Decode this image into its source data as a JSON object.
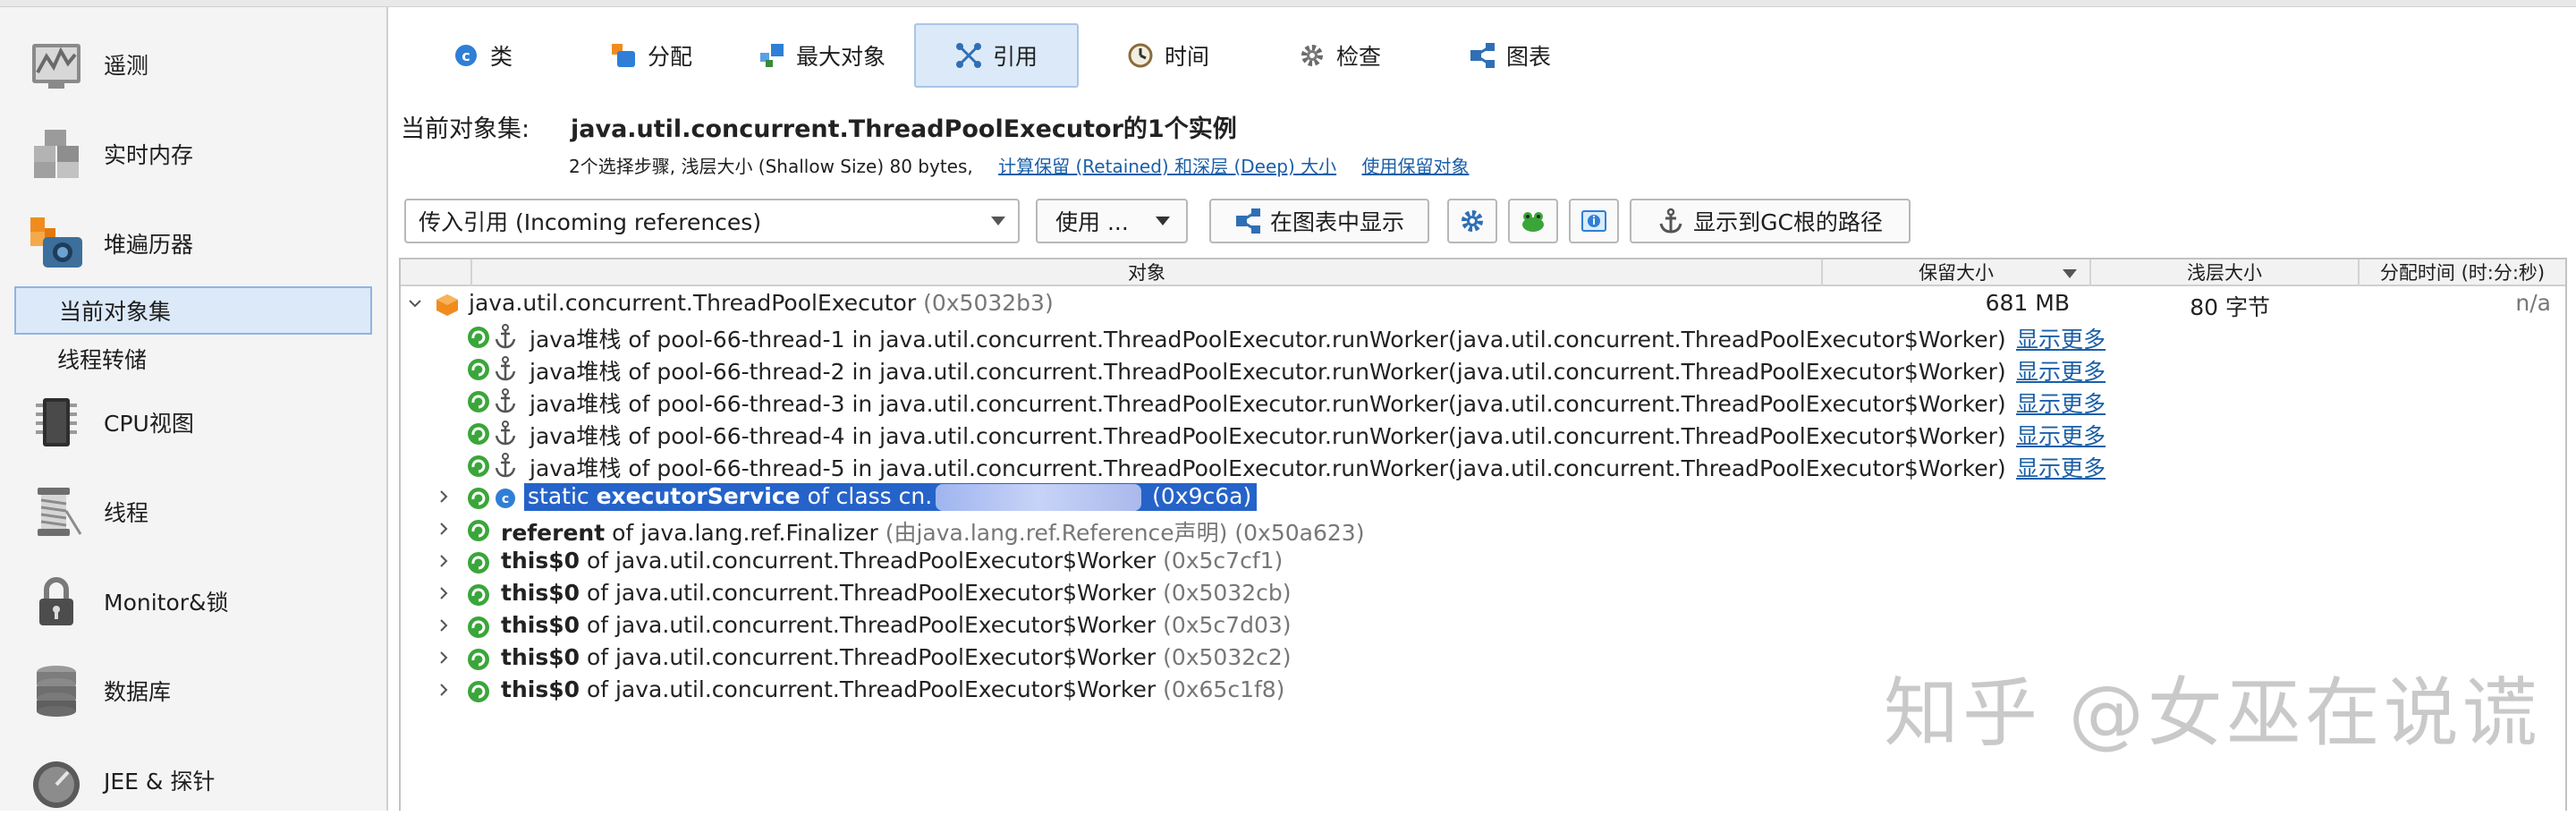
{
  "sidebar": {
    "items": [
      {
        "label": "遥测",
        "icon": "telemetry-icon"
      },
      {
        "label": "实时内存",
        "icon": "live-memory-icon"
      },
      {
        "label": "堆遍历器",
        "icon": "heap-walker-icon"
      },
      {
        "label": "当前对象集",
        "icon": ""
      },
      {
        "label": "线程转储",
        "icon": ""
      },
      {
        "label": "CPU视图",
        "icon": "cpu-icon"
      },
      {
        "label": "线程",
        "icon": "threads-icon"
      },
      {
        "label": "Monitor&锁",
        "icon": "lock-icon"
      },
      {
        "label": "数据库",
        "icon": "database-icon"
      },
      {
        "label": "JEE & 探针",
        "icon": "gauge-icon"
      }
    ]
  },
  "tabs": [
    {
      "label": "类",
      "icon": "class-icon"
    },
    {
      "label": "分配",
      "icon": "allocation-icon"
    },
    {
      "label": "最大对象",
      "icon": "biggest-objects-icon"
    },
    {
      "label": "引用",
      "icon": "references-icon"
    },
    {
      "label": "时间",
      "icon": "clock-icon"
    },
    {
      "label": "检查",
      "icon": "gear-icon"
    },
    {
      "label": "图表",
      "icon": "graph-icon"
    }
  ],
  "object_set": {
    "label": "当前对象集:",
    "value": "java.util.concurrent.ThreadPoolExecutor的1个实例",
    "steps": "2个选择步骤, 浅层大小 (Shallow Size) 80 bytes,",
    "link_retained": "计算保留 (Retained) 和深层 (Deep) 大小",
    "link_use": "使用保留对象"
  },
  "toolbar": {
    "reference_type": "传入引用 (Incoming references)",
    "use_label": "使用 ...",
    "show_in_graph": "在图表中显示",
    "show_gc_path": "显示到GC根的路径"
  },
  "table": {
    "headers": [
      "对象",
      "保留大小",
      "浅层大小",
      "分配时间 (时:分:秒)"
    ],
    "root": {
      "name": "java.util.concurrent.ThreadPoolExecutor",
      "addr": "(0x5032b3)",
      "retained": "681 MB",
      "shallow": "80 字节",
      "time": "n/a"
    },
    "stack_rows": [
      {
        "text": "java堆栈 of pool-66-thread-1 in java.util.concurrent.ThreadPoolExecutor.runWorker(java.util.concurrent.ThreadPoolExecutor$Worker)",
        "more": "显示更多"
      },
      {
        "text": "java堆栈 of pool-66-thread-2 in java.util.concurrent.ThreadPoolExecutor.runWorker(java.util.concurrent.ThreadPoolExecutor$Worker)",
        "more": "显示更多"
      },
      {
        "text": "java堆栈 of pool-66-thread-3 in java.util.concurrent.ThreadPoolExecutor.runWorker(java.util.concurrent.ThreadPoolExecutor$Worker)",
        "more": "显示更多"
      },
      {
        "text": "java堆栈 of pool-66-thread-4 in java.util.concurrent.ThreadPoolExecutor.runWorker(java.util.concurrent.ThreadPoolExecutor$Worker)",
        "more": "显示更多"
      },
      {
        "text": "java堆栈 of pool-66-thread-5 in java.util.concurrent.ThreadPoolExecutor.runWorker(java.util.concurrent.ThreadPoolExecutor$Worker)",
        "more": "显示更多"
      }
    ],
    "static_row": {
      "prefix": "static ",
      "field": "executorService",
      "mid": " of class cn.",
      "addr": "(0x9c6a)"
    },
    "referent_row": {
      "field": "referent",
      "mid": " of java.lang.ref.Finalizer ",
      "note": "(由java.lang.ref.Reference声明)",
      "addr": "(0x50a623)"
    },
    "worker_rows": [
      {
        "field": "this$0",
        "mid": " of java.util.concurrent.ThreadPoolExecutor$Worker ",
        "addr": "(0x5c7cf1)"
      },
      {
        "field": "this$0",
        "mid": " of java.util.concurrent.ThreadPoolExecutor$Worker ",
        "addr": "(0x5032cb)"
      },
      {
        "field": "this$0",
        "mid": " of java.util.concurrent.ThreadPoolExecutor$Worker ",
        "addr": "(0x5c7d03)"
      },
      {
        "field": "this$0",
        "mid": " of java.util.concurrent.ThreadPoolExecutor$Worker ",
        "addr": "(0x5032c2)"
      },
      {
        "field": "this$0",
        "mid": " of java.util.concurrent.ThreadPoolExecutor$Worker ",
        "addr": "(0x65c1f8)"
      }
    ]
  },
  "watermark": "知乎 @女巫在说谎",
  "colors": {
    "accent": "#2563c9",
    "link": "#1a5fa8",
    "selected_bg": "#dce9f8",
    "gc_green": "#3aa63a"
  }
}
